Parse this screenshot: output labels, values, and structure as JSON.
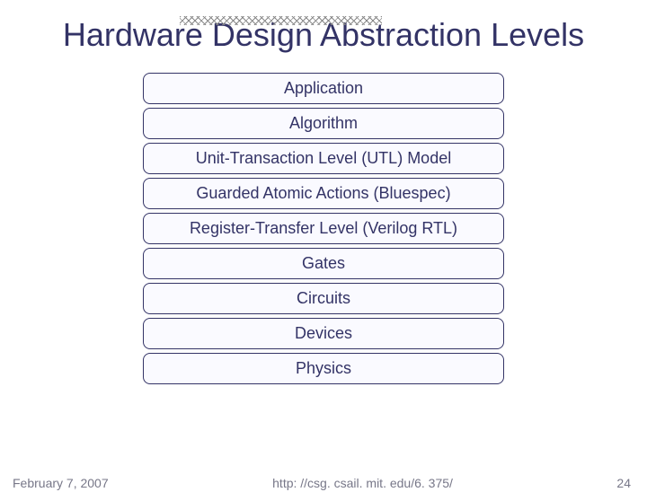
{
  "title": "Hardware Design Abstraction Levels",
  "levels": [
    "Application",
    "Algorithm",
    "Unit-Transaction Level (UTL) Model",
    "Guarded Atomic Actions (Bluespec)",
    "Register-Transfer Level (Verilog RTL)",
    "Gates",
    "Circuits",
    "Devices",
    "Physics"
  ],
  "footer": {
    "date": "February 7, 2007",
    "url": "http: //csg. csail. mit. edu/6. 375/",
    "page": "24"
  }
}
